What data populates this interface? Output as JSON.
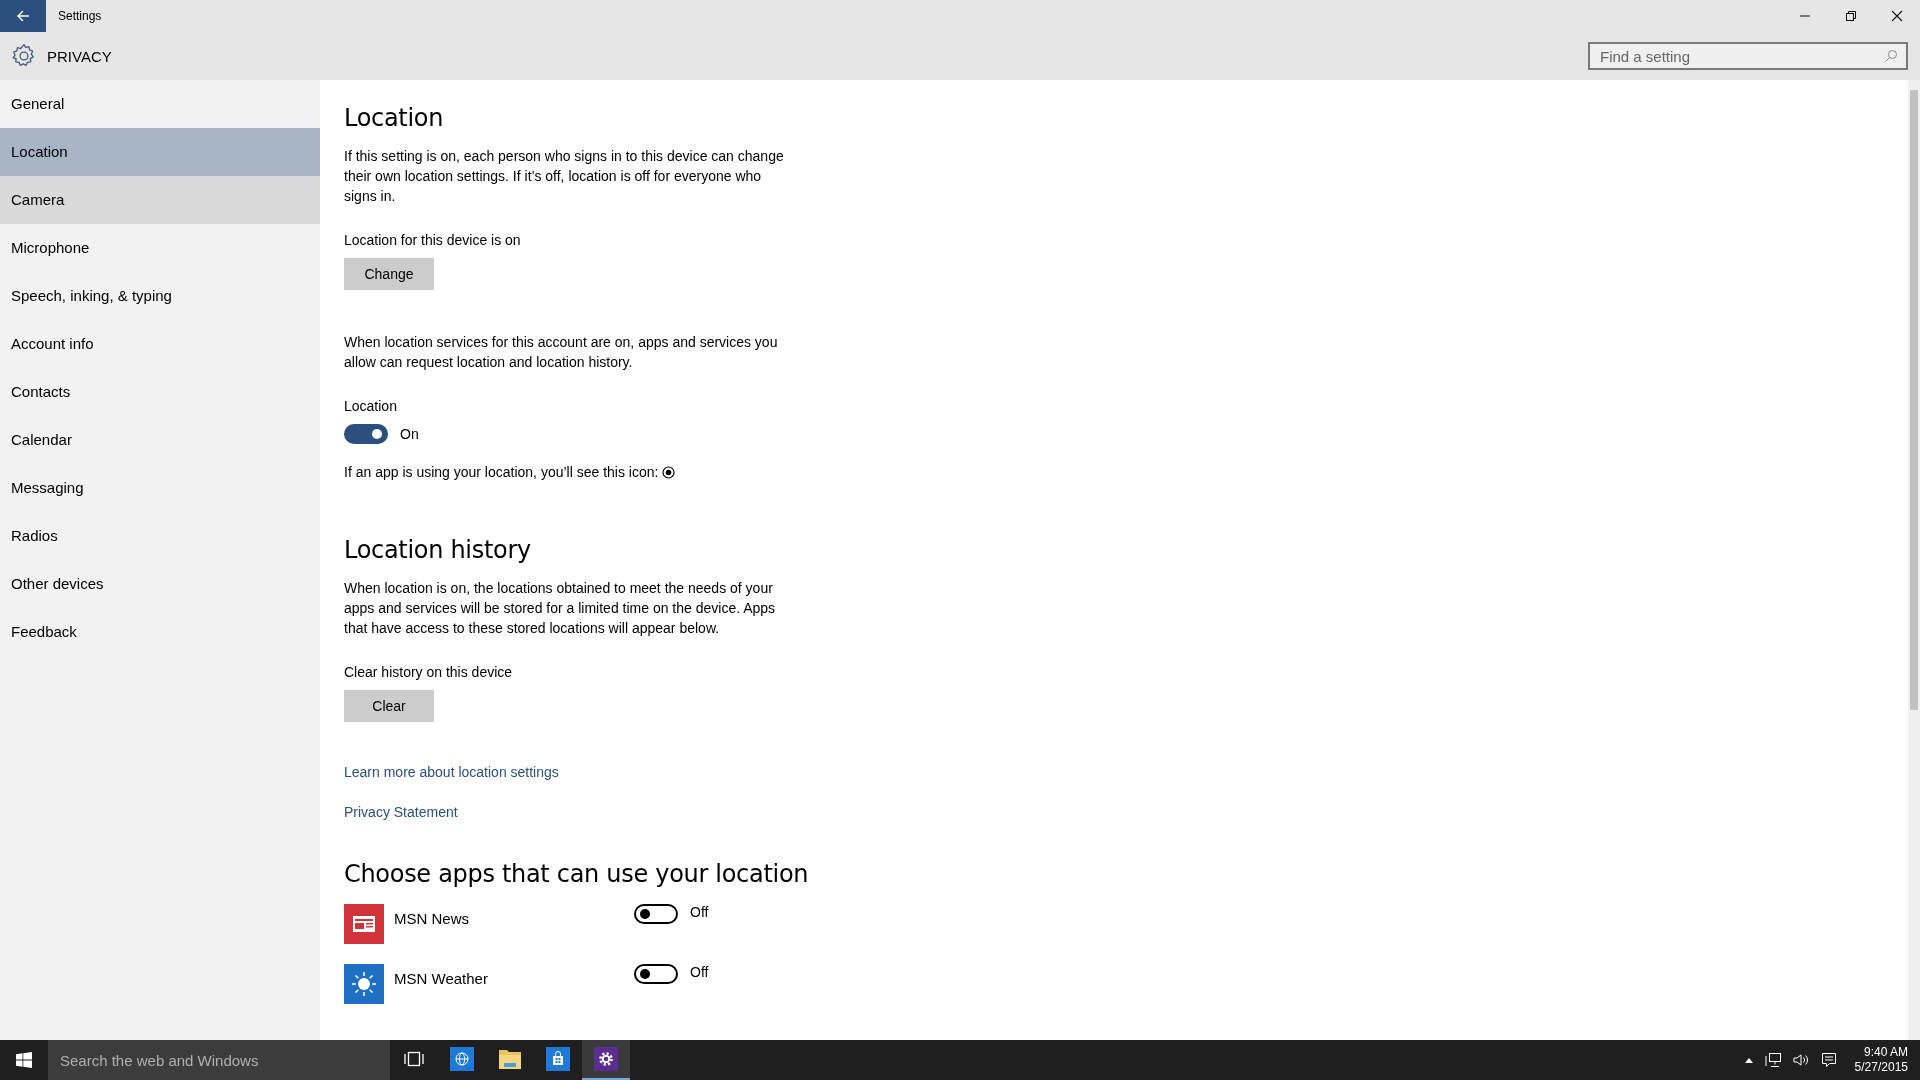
{
  "window": {
    "title": "Settings"
  },
  "header": {
    "title": "PRIVACY",
    "search": {
      "placeholder": "Find a setting"
    }
  },
  "sidebar": {
    "items": [
      {
        "label": "General",
        "selected": false,
        "hovered": false
      },
      {
        "label": "Location",
        "selected": true,
        "hovered": false
      },
      {
        "label": "Camera",
        "selected": false,
        "hovered": true
      },
      {
        "label": "Microphone",
        "selected": false,
        "hovered": false
      },
      {
        "label": "Speech, inking, & typing",
        "selected": false,
        "hovered": false
      },
      {
        "label": "Account info",
        "selected": false,
        "hovered": false
      },
      {
        "label": "Contacts",
        "selected": false,
        "hovered": false
      },
      {
        "label": "Calendar",
        "selected": false,
        "hovered": false
      },
      {
        "label": "Messaging",
        "selected": false,
        "hovered": false
      },
      {
        "label": "Radios",
        "selected": false,
        "hovered": false
      },
      {
        "label": "Other devices",
        "selected": false,
        "hovered": false
      },
      {
        "label": "Feedback",
        "selected": false,
        "hovered": false
      }
    ]
  },
  "content": {
    "location": {
      "heading": "Location",
      "description": "If this setting is on, each person who signs in to this device can change their own location settings. If it’s off, location is off for everyone who signs in.",
      "device_status": "Location for this device is on",
      "change_button": "Change",
      "account_description": "When location services for this account are on, apps and services you allow can request location and location history.",
      "toggle": {
        "label": "Location",
        "on": true,
        "state_text": "On"
      },
      "icon_note": "If an app is using your location, you’ll see this icon:"
    },
    "history": {
      "heading": "Location history",
      "description": "When location is on, the locations obtained to meet the needs of your apps and services will be stored for a limited time on the device. Apps that have access to these stored locations will appear below.",
      "clear_label": "Clear history on this device",
      "clear_button": "Clear"
    },
    "links": [
      "Learn more about location settings",
      "Privacy Statement"
    ],
    "apps": {
      "heading": "Choose apps that can use your location",
      "items": [
        {
          "name": "MSN News",
          "kind": "news",
          "on": false,
          "state_text": "Off"
        },
        {
          "name": "MSN Weather",
          "kind": "weather",
          "on": false,
          "state_text": "Off"
        }
      ]
    }
  },
  "taskbar": {
    "search": {
      "placeholder": "Search the web and Windows"
    },
    "apps": [
      {
        "kind": "browser",
        "selected": false
      },
      {
        "kind": "folder",
        "selected": false
      },
      {
        "kind": "store",
        "selected": false
      },
      {
        "kind": "settings",
        "selected": true
      }
    ],
    "time": "9:40 AM",
    "date": "5/27/2015"
  }
}
